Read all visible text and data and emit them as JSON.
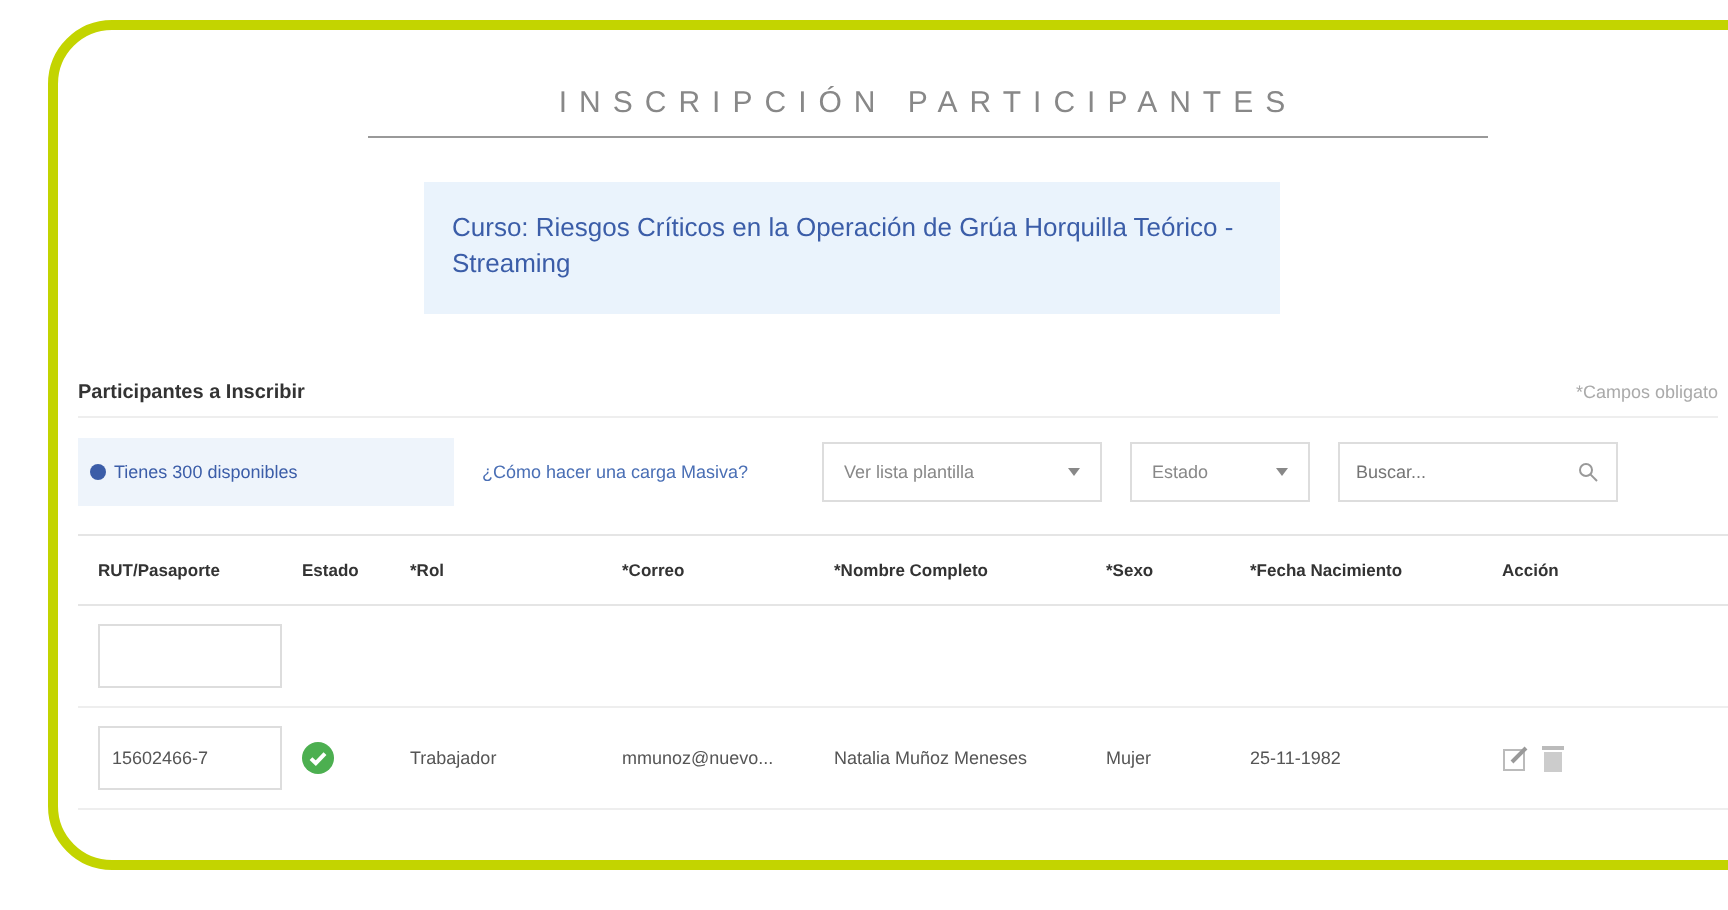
{
  "title": "INSCRIPCIÓN PARTICIPANTES",
  "course": "Curso: Riesgos Críticos en la Operación de Grúa Horquilla Teórico - Streaming",
  "section": {
    "label": "Participantes a Inscribir",
    "required_note": "*Campos obligato"
  },
  "toolbar": {
    "info": "Tienes 300 disponibles",
    "help_link": "¿Cómo hacer una carga Masiva?",
    "template_select": "Ver lista plantilla",
    "status_select": "Estado",
    "search": {
      "placeholder": "Buscar..."
    }
  },
  "table": {
    "columns": [
      "RUT/Pasaporte",
      "Estado",
      "*Rol",
      "*Correo",
      "*Nombre Completo",
      "*Sexo",
      "*Fecha Nacimiento",
      "Acción"
    ],
    "rows": [
      {
        "kind": "new"
      },
      {
        "kind": "entry",
        "rut": "15602466-7",
        "valid": true,
        "role": "Trabajador",
        "email": "mmunoz@nuevo...",
        "name": "Natalia Muñoz Meneses",
        "sex": "Mujer",
        "birth": "25-11-1982"
      }
    ]
  }
}
